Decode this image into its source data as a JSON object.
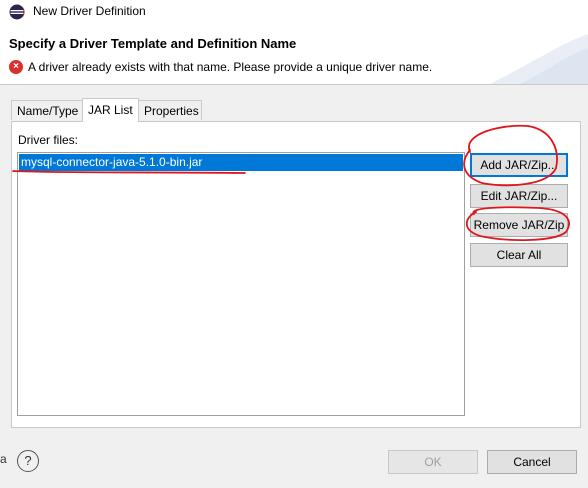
{
  "window": {
    "title": "New Driver Definition"
  },
  "header": {
    "title": "Specify a Driver Template and Definition Name",
    "error_message": "A driver already exists with that name. Please provide a unique driver name.",
    "error_icon": "error-icon"
  },
  "tabs": [
    {
      "label": "Name/Type",
      "active": false
    },
    {
      "label": "JAR List",
      "active": true
    },
    {
      "label": "Properties",
      "active": false
    }
  ],
  "jar_list": {
    "label": "Driver files:",
    "files": [
      "mysql-connector-java-5.1.0-bin.jar"
    ]
  },
  "side_buttons": {
    "add": "Add JAR/Zip...",
    "edit": "Edit JAR/Zip...",
    "remove": "Remove JAR/Zip",
    "clear": "Clear All"
  },
  "footer": {
    "help_glyph": "?",
    "stray_text": "a",
    "ok_label": "OK",
    "ok_enabled": false,
    "cancel_label": "Cancel"
  },
  "colors": {
    "selection": "#0078d7",
    "annotation": "#e0161b",
    "error": "#d9302b"
  }
}
